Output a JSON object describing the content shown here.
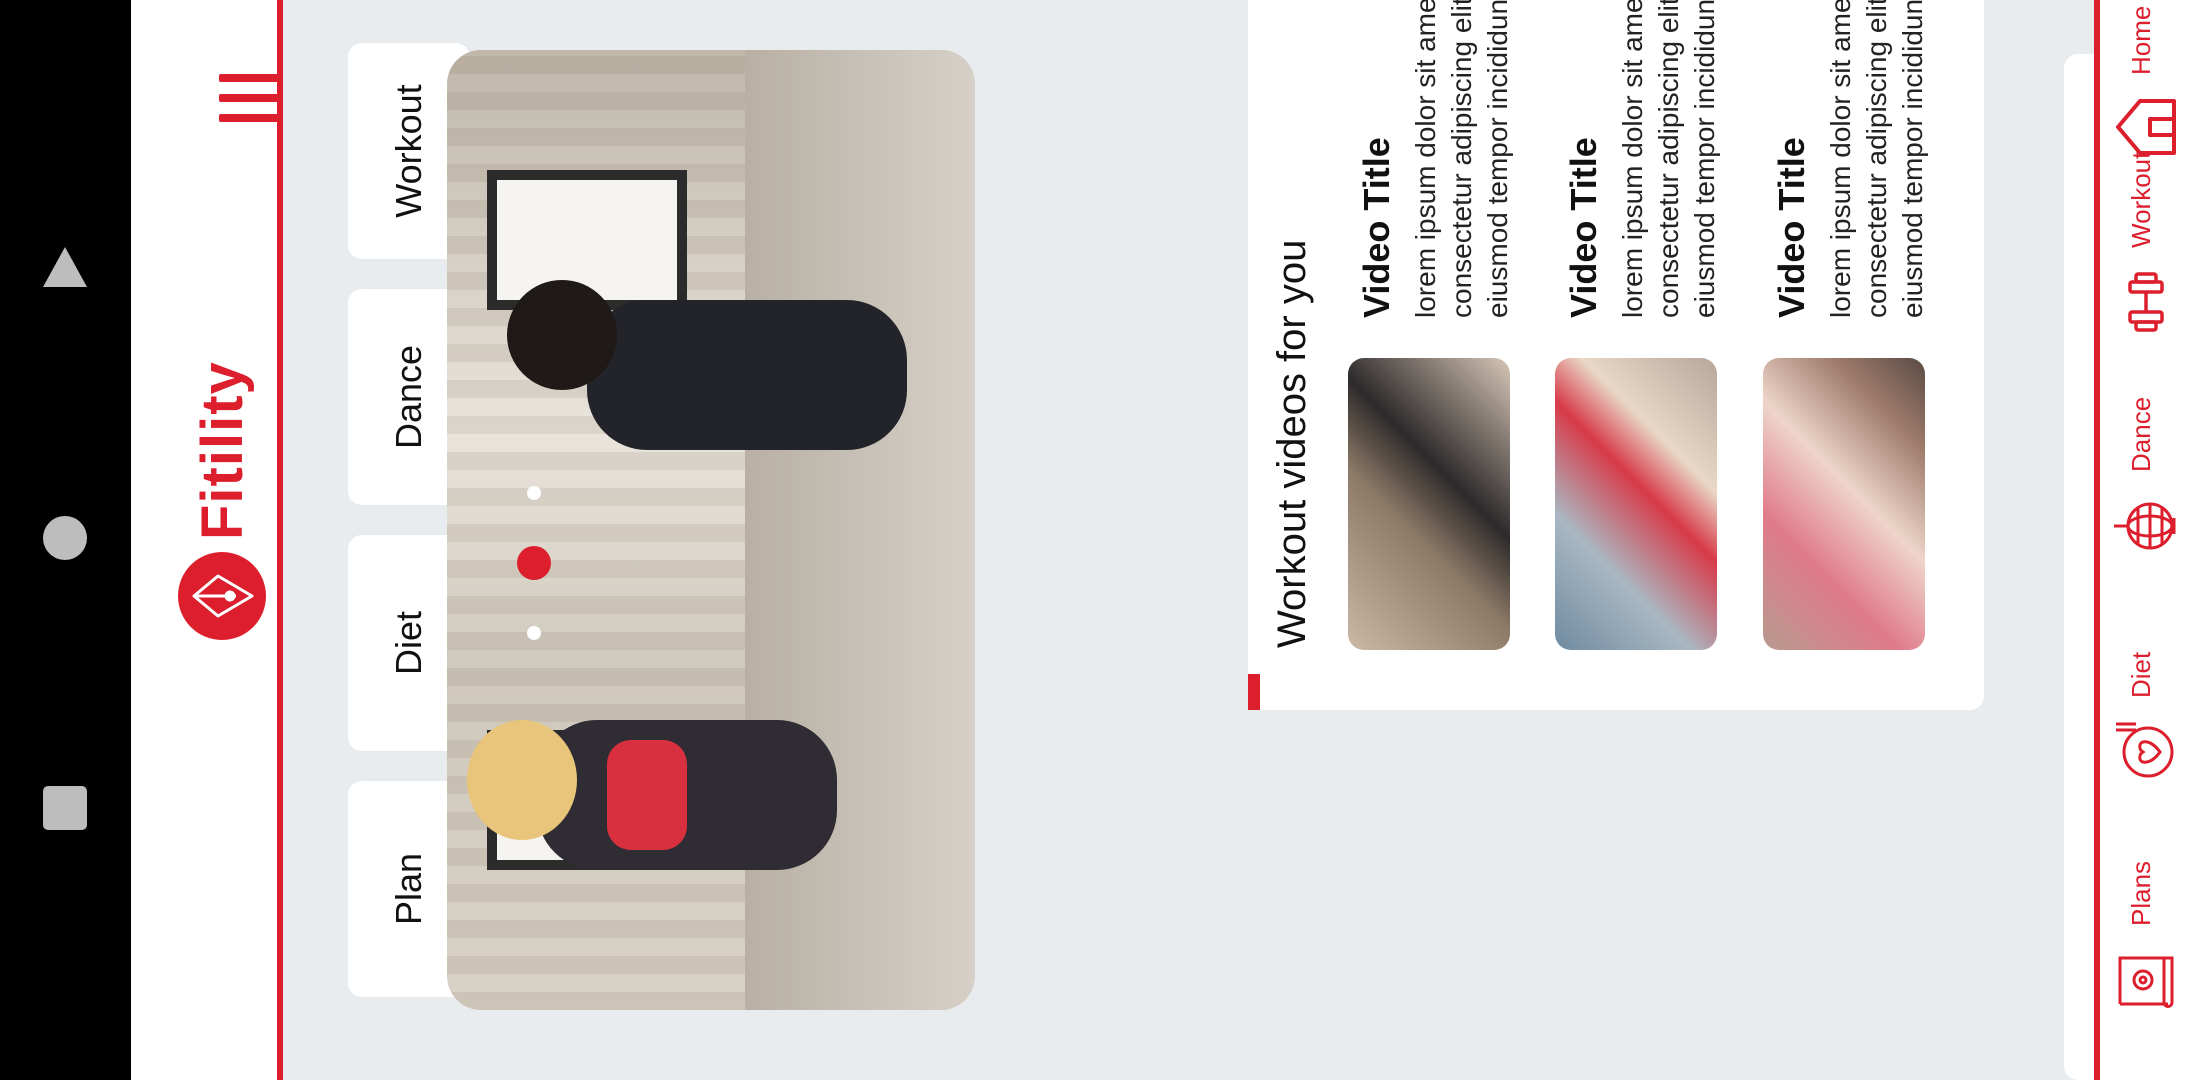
{
  "app": {
    "name": "Fitility",
    "brand_color": "#dc1e2d",
    "background": "#e9ecef"
  },
  "header": {
    "brand": "Fitility",
    "menu_icon": "hamburger-menu-icon",
    "logo_icon": "pen-nib-logo-icon"
  },
  "categories": [
    {
      "label": "Workout"
    },
    {
      "label": "Dance"
    },
    {
      "label": "Diet"
    },
    {
      "label": "Plan"
    }
  ],
  "hero": {
    "image": "two women high-five in a gym studio",
    "slides_total": 3,
    "active_slide_index": 1
  },
  "videos": {
    "heading": "Workout videos for you",
    "items": [
      {
        "title": "Video Title",
        "desc_line1": "lorem ipsum dolor sit amet,",
        "desc_line2": "consectetur adipiscing elit, sed do",
        "desc_line3": "eiusmod tempor incididunt ut labore ...",
        "thumb": "couple-stretching-thumbnail"
      },
      {
        "title": "Video Title",
        "desc_line1": "lorem ipsum dolor sit amet,",
        "desc_line2": "consectetur adipiscing elit, sed do",
        "desc_line3": "eiusmod tempor incididunt ut labore ...",
        "thumb": "woman-jumping-rope-thumbnail"
      },
      {
        "title": "Video Title",
        "desc_line1": "lorem ipsum dolor sit amet,",
        "desc_line2": "consectetur adipiscing elit, sed do",
        "desc_line3": "eiusmod tempor incididunt ut labore ...",
        "thumb": "group-fitness-class-thumbnail"
      }
    ]
  },
  "bottom_nav": [
    {
      "label": "Home",
      "icon": "home-icon"
    },
    {
      "label": "Workout",
      "icon": "dumbbell-icon"
    },
    {
      "label": "Dance",
      "icon": "disco-ball-icon"
    },
    {
      "label": "Diet",
      "icon": "heart-plate-icon"
    },
    {
      "label": "Plans",
      "icon": "settings-scroll-icon"
    }
  ],
  "system_nav": {
    "back": "back-triangle-icon",
    "home": "home-circle-icon",
    "recents": "recents-square-icon"
  }
}
